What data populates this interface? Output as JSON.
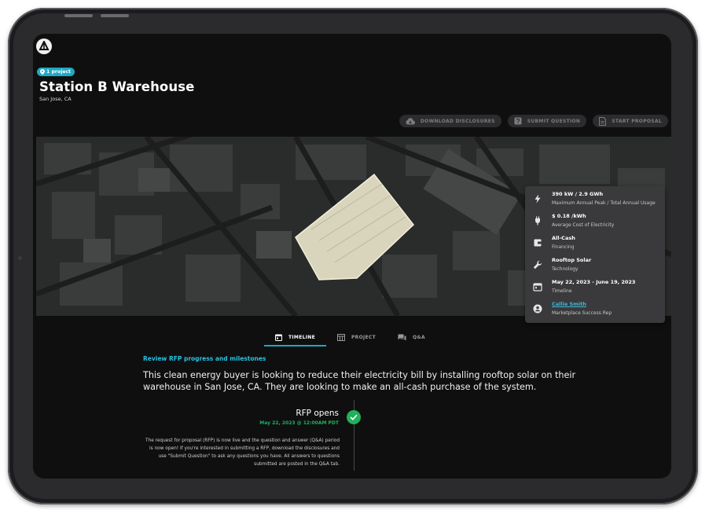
{
  "site": {
    "badge": "1 project",
    "title": "Station B Warehouse",
    "location": "San Jose, CA"
  },
  "actions": [
    {
      "label": "DOWNLOAD DISCLOSURES",
      "icon": "cloud-download-icon"
    },
    {
      "label": "SUBMIT QUESTION",
      "icon": "question-icon"
    },
    {
      "label": "START PROPOSAL",
      "icon": "document-icon"
    }
  ],
  "details": [
    {
      "value": "390 kW / 2.9 GWh",
      "label": "Maximum Annual Peak / Total Annual Usage",
      "icon": "bolt-icon"
    },
    {
      "value": "$ 0.18 /kWh",
      "label": "Average Cost of Electricity",
      "icon": "plug-icon"
    },
    {
      "value": "All-Cash",
      "label": "Financing",
      "icon": "wallet-icon"
    },
    {
      "value": "Rooftop Solar",
      "label": "Technology",
      "icon": "wrench-icon"
    },
    {
      "value": "May 22, 2023 - June 19, 2023",
      "label": "Timeline",
      "icon": "calendar-icon"
    },
    {
      "value": "Callie Smith",
      "label": "Marketplace Success Rep",
      "icon": "person-icon"
    }
  ],
  "tabs": [
    {
      "label": "TIMELINE",
      "icon": "calendar-icon",
      "active": true
    },
    {
      "label": "PROJECT",
      "icon": "grid-icon",
      "active": false
    },
    {
      "label": "Q&A",
      "icon": "chat-icon",
      "active": false
    }
  ],
  "timeline": {
    "section_label": "Review RFP progress and milestones",
    "description": "This clean energy buyer is looking to reduce their electricity bill by installing rooftop solar on their warehouse in San Jose, CA. They are looking to make an all-cash purchase of the system.",
    "events": [
      {
        "title": "RFP opens",
        "date": "May 22, 2023 @ 12:00AM PDT",
        "body": "The request for proposal (RFP) is now live and the question and answer (Q&A) period is now open! If you're interested in submitting a RFP, download the disclosures and use \"Submit Question\" to ask any questions you have. All answers to questions submitted are posted in the Q&A tab."
      }
    ]
  },
  "colors": {
    "accent": "#1ea8c4",
    "success": "#21b05c",
    "background": "#0f0f10",
    "card": "#3a3a3c"
  }
}
